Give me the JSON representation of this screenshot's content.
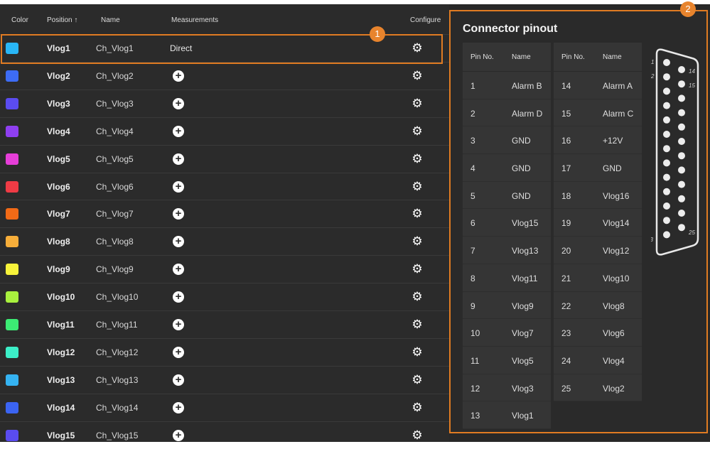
{
  "table": {
    "headers": {
      "color": "Color",
      "position": "Position ↑",
      "name": "Name",
      "measurements": "Measurements",
      "configure": "Configure"
    },
    "rows": [
      {
        "color": "#29b6f6",
        "position": "Vlog1",
        "name": "Ch_Vlog1",
        "measurement": "Direct"
      },
      {
        "color": "#3d6cf5",
        "position": "Vlog2",
        "name": "Ch_Vlog2",
        "measurement": ""
      },
      {
        "color": "#5b4cf0",
        "position": "Vlog3",
        "name": "Ch_Vlog3",
        "measurement": ""
      },
      {
        "color": "#8f3ff0",
        "position": "Vlog4",
        "name": "Ch_Vlog4",
        "measurement": ""
      },
      {
        "color": "#e63ed8",
        "position": "Vlog5",
        "name": "Ch_Vlog5",
        "measurement": ""
      },
      {
        "color": "#ef3b45",
        "position": "Vlog6",
        "name": "Ch_Vlog6",
        "measurement": ""
      },
      {
        "color": "#f26a16",
        "position": "Vlog7",
        "name": "Ch_Vlog7",
        "measurement": ""
      },
      {
        "color": "#f7ae3a",
        "position": "Vlog8",
        "name": "Ch_Vlog8",
        "measurement": ""
      },
      {
        "color": "#f7f33a",
        "position": "Vlog9",
        "name": "Ch_Vlog9",
        "measurement": ""
      },
      {
        "color": "#a8f03e",
        "position": "Vlog10",
        "name": "Ch_Vlog10",
        "measurement": ""
      },
      {
        "color": "#3cec74",
        "position": "Vlog11",
        "name": "Ch_Vlog11",
        "measurement": ""
      },
      {
        "color": "#3cefc8",
        "position": "Vlog12",
        "name": "Ch_Vlog12",
        "measurement": ""
      },
      {
        "color": "#35b3f2",
        "position": "Vlog13",
        "name": "Ch_Vlog13",
        "measurement": ""
      },
      {
        "color": "#3b64f2",
        "position": "Vlog14",
        "name": "Ch_Vlog14",
        "measurement": ""
      },
      {
        "color": "#5a4cf0",
        "position": "Vlog15",
        "name": "Ch_Vlog15",
        "measurement": ""
      }
    ]
  },
  "badges": {
    "first": "1",
    "second": "2"
  },
  "pinout": {
    "title": "Connector pinout",
    "headers": {
      "pin": "Pin No.",
      "name": "Name"
    },
    "left": [
      {
        "pin": "1",
        "name": "Alarm B"
      },
      {
        "pin": "2",
        "name": "Alarm D"
      },
      {
        "pin": "3",
        "name": "GND"
      },
      {
        "pin": "4",
        "name": "GND"
      },
      {
        "pin": "5",
        "name": "GND"
      },
      {
        "pin": "6",
        "name": "Vlog15"
      },
      {
        "pin": "7",
        "name": "Vlog13"
      },
      {
        "pin": "8",
        "name": "Vlog11"
      },
      {
        "pin": "9",
        "name": "Vlog9"
      },
      {
        "pin": "10",
        "name": "Vlog7"
      },
      {
        "pin": "11",
        "name": "Vlog5"
      },
      {
        "pin": "12",
        "name": "Vlog3"
      },
      {
        "pin": "13",
        "name": "Vlog1"
      }
    ],
    "right": [
      {
        "pin": "14",
        "name": "Alarm A"
      },
      {
        "pin": "15",
        "name": "Alarm C"
      },
      {
        "pin": "16",
        "name": "+12V"
      },
      {
        "pin": "17",
        "name": "GND"
      },
      {
        "pin": "18",
        "name": "Vlog16"
      },
      {
        "pin": "19",
        "name": "Vlog14"
      },
      {
        "pin": "20",
        "name": "Vlog12"
      },
      {
        "pin": "21",
        "name": "Vlog10"
      },
      {
        "pin": "22",
        "name": "Vlog8"
      },
      {
        "pin": "23",
        "name": "Vlog6"
      },
      {
        "pin": "24",
        "name": "Vlog4"
      },
      {
        "pin": "25",
        "name": "Vlog2"
      }
    ],
    "connector_labels": {
      "pin1": "1",
      "pin2": "2",
      "pin13": "13",
      "pin14": "14",
      "pin15": "15",
      "pin25": "25"
    }
  }
}
